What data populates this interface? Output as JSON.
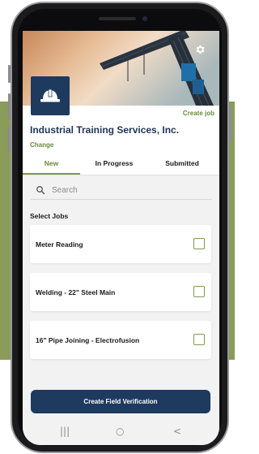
{
  "header": {
    "settings_icon": "gear-icon",
    "create_job_label": "Create job",
    "logo_icon": "hard-hat-icon",
    "company_name": "Industrial Training Services, Inc.",
    "change_label": "Change"
  },
  "tabs": [
    {
      "label": "New",
      "active": true
    },
    {
      "label": "In Progress",
      "active": false
    },
    {
      "label": "Submitted",
      "active": false
    }
  ],
  "search": {
    "placeholder": "Search",
    "value": ""
  },
  "section_label": "Select Jobs",
  "jobs": [
    {
      "label": "Meter Reading",
      "checked": false
    },
    {
      "label": "Welding - 22\" Steel Main",
      "checked": false
    },
    {
      "label": "16\" Pipe Joining - Electrofusion",
      "checked": false
    }
  ],
  "cta_label": "Create Field Verification",
  "nav": {
    "recent": "|||",
    "home": "○",
    "back": "<"
  },
  "colors": {
    "primary": "#1e3a5f",
    "accent": "#7e9b4e",
    "band": "#8a9b5a"
  }
}
